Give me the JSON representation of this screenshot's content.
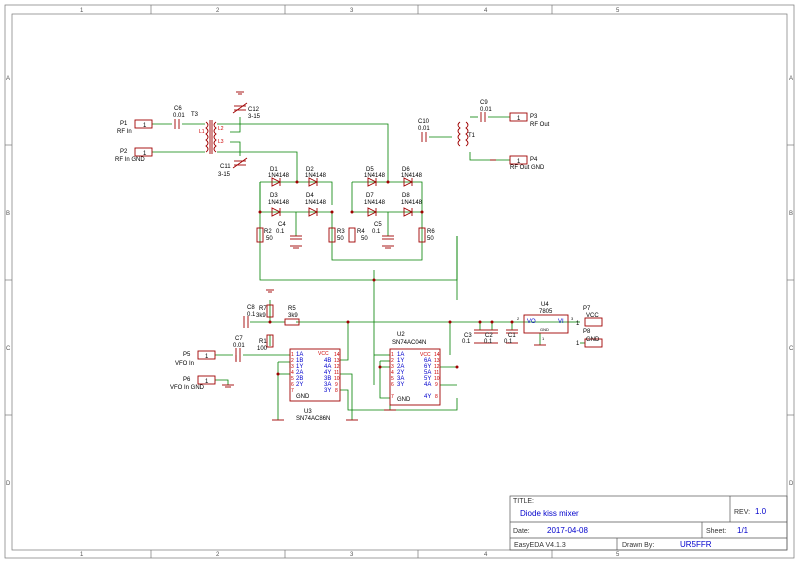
{
  "frame": {
    "cols": [
      "1",
      "2",
      "3",
      "4",
      "5"
    ],
    "rows": [
      "A",
      "B",
      "C",
      "D"
    ]
  },
  "title_block": {
    "title_label": "TITLE:",
    "title": "Diode kiss mixer",
    "rev_label": "REV:",
    "rev": "1.0",
    "date_label": "Date:",
    "date": "2017-04-08",
    "sheet_label": "Sheet:",
    "sheet": "1/1",
    "tool": "EasyEDA V4.1.3",
    "drawn_label": "Drawn By:",
    "drawn_by": "UR5FFR"
  },
  "ports": {
    "p1": {
      "ref": "P1",
      "name": "RF In",
      "pin": "1"
    },
    "p2": {
      "ref": "P2",
      "name": "RF In GND",
      "pin": "1"
    },
    "p3": {
      "ref": "P3",
      "name": "RF Out",
      "pin": "1"
    },
    "p4": {
      "ref": "P4",
      "name": "RF Out GND",
      "pin": "1"
    },
    "p5": {
      "ref": "P5",
      "name": "VFO In",
      "pin": "1"
    },
    "p6": {
      "ref": "P6",
      "name": "VFO In GND",
      "pin": "1"
    },
    "p7": {
      "ref": "P7",
      "name": "VCC",
      "pin": "1"
    },
    "p8": {
      "ref": "P8",
      "name": "GND",
      "pin": "1"
    }
  },
  "caps": {
    "c6": {
      "ref": "C6",
      "val": "0.01"
    },
    "c9": {
      "ref": "C9",
      "val": "0.01"
    },
    "c10": {
      "ref": "C10",
      "val": "0.01"
    },
    "c11": {
      "ref": "C11",
      "val": "3-15"
    },
    "c12": {
      "ref": "C12",
      "val": "3-15"
    },
    "c4": {
      "ref": "C4",
      "val": "0.1"
    },
    "c5": {
      "ref": "C5",
      "val": "0.1"
    },
    "c7": {
      "ref": "C7",
      "val": "0.01"
    },
    "c8": {
      "ref": "C8",
      "val": "0.1"
    },
    "c1": {
      "ref": "C1",
      "val": "0.1"
    },
    "c2": {
      "ref": "C2",
      "val": "0.1"
    },
    "c3": {
      "ref": "C3",
      "val": "0.1"
    }
  },
  "res": {
    "r1": {
      "ref": "R1",
      "val": "100"
    },
    "r2": {
      "ref": "R2",
      "val": "50"
    },
    "r3": {
      "ref": "R3",
      "val": "50"
    },
    "r4": {
      "ref": "R4",
      "val": "50"
    },
    "r5": {
      "ref": "R5",
      "val": "3k9"
    },
    "r6": {
      "ref": "R6",
      "val": "50"
    },
    "r7": {
      "ref": "R7",
      "val": "3k9"
    }
  },
  "diodes": {
    "d1": {
      "ref": "D1",
      "val": "1N4148"
    },
    "d2": {
      "ref": "D2",
      "val": "1N4148"
    },
    "d3": {
      "ref": "D3",
      "val": "1N4148"
    },
    "d4": {
      "ref": "D4",
      "val": "1N4148"
    },
    "d5": {
      "ref": "D5",
      "val": "1N4148"
    },
    "d6": {
      "ref": "D6",
      "val": "1N4148"
    },
    "d7": {
      "ref": "D7",
      "val": "1N4148"
    },
    "d8": {
      "ref": "D8",
      "val": "1N4148"
    }
  },
  "transformers": {
    "t1": {
      "ref": "T1"
    },
    "t3": {
      "ref": "T3",
      "l1": "L1",
      "l2": "L2",
      "l3": "L3"
    }
  },
  "u4": {
    "ref": "U4",
    "val": "7805",
    "vo": "VO",
    "vi": "VI",
    "gnd": "GND",
    "p2": "2",
    "p3": "3",
    "p1": "1"
  },
  "u2": {
    "ref": "U2",
    "val": "SN74AC04N",
    "vcc": "VCC",
    "gnd": "GND",
    "left_labels": [
      "1A",
      "1Y",
      "2A",
      "2Y",
      "3A",
      "3Y"
    ],
    "left_pins": [
      "1",
      "2",
      "3",
      "4",
      "5",
      "6",
      "7"
    ],
    "right_labels": [
      "6A",
      "6Y",
      "5A",
      "5Y",
      "4A",
      "4Y"
    ],
    "right_pins": [
      "14",
      "13",
      "12",
      "11",
      "10",
      "9",
      "8"
    ]
  },
  "u3": {
    "ref": "U3",
    "val": "SN74AC86N",
    "vcc": "VCC",
    "gnd": "GND",
    "left_labels": [
      "1A",
      "1B",
      "1Y",
      "2A",
      "2B",
      "2Y"
    ],
    "left_pins": [
      "1",
      "2",
      "3",
      "4",
      "5",
      "6",
      "7"
    ],
    "right_labels": [
      "4B",
      "4A",
      "4Y",
      "3B",
      "3A",
      "3Y"
    ],
    "right_pins": [
      "14",
      "13",
      "12",
      "11",
      "10",
      "9",
      "8"
    ]
  },
  "colors": {
    "wire": "#008000",
    "part": "#a00000",
    "label": "#0000cc",
    "pin": "#cc0000",
    "frame": "#777777"
  }
}
